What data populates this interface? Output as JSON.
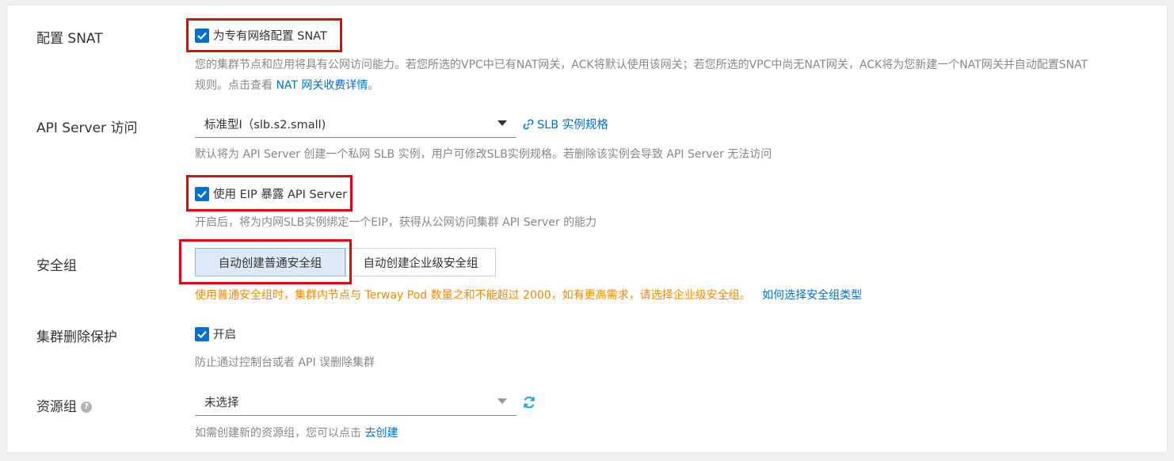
{
  "snat": {
    "label": "配置 SNAT",
    "checkbox_label": "为专有网络配置 SNAT",
    "checked": true,
    "desc_line1": "您的集群节点和应用将具有公网访问能力。若您所选的VPC中已有NAT网关，ACK将默认使用该网关；若您所选的VPC中尚无NAT网关，ACK将为您新建一个NAT网关并自动配置SNAT",
    "desc_line2_prefix": "规则。点击查看 ",
    "desc_link": "NAT 网关收费详情",
    "desc_line2_suffix": "。"
  },
  "api_server": {
    "label": "API Server 访问",
    "select_value": "标准型I（slb.s2.small)",
    "spec_link": "SLB 实例规格",
    "desc": "默认将为 API Server 创建一个私网 SLB 实例，用户可修改SLB实例规格。若删除该实例会导致 API Server 无法访问",
    "eip_checkbox_label": "使用 EIP 暴露 API Server",
    "eip_checked": true,
    "eip_desc": "开启后，将为内网SLB实例绑定一个EIP，获得从公网访问集群 API Server 的能力"
  },
  "security_group": {
    "label": "安全组",
    "options": [
      "自动创建普通安全组",
      "自动创建企业级安全组"
    ],
    "selected_index": 0,
    "warning": "使用普通安全组时，集群内节点与 Terway Pod 数量之和不能超过 2000，如有更高需求，请选择企业级安全组。",
    "help_link": "如何选择安全组类型"
  },
  "deletion_protection": {
    "label": "集群删除保护",
    "checkbox_label": "开启",
    "checked": true,
    "desc": "防止通过控制台或者 API 误删除集群"
  },
  "resource_group": {
    "label": "资源组",
    "select_value": "未选择",
    "desc_prefix": "如需创建新的资源组，您可以点击 ",
    "desc_link": "去创建"
  },
  "colors": {
    "accent": "#0070cc",
    "warning": "#f08a00",
    "highlight_border": "#e8000b"
  }
}
